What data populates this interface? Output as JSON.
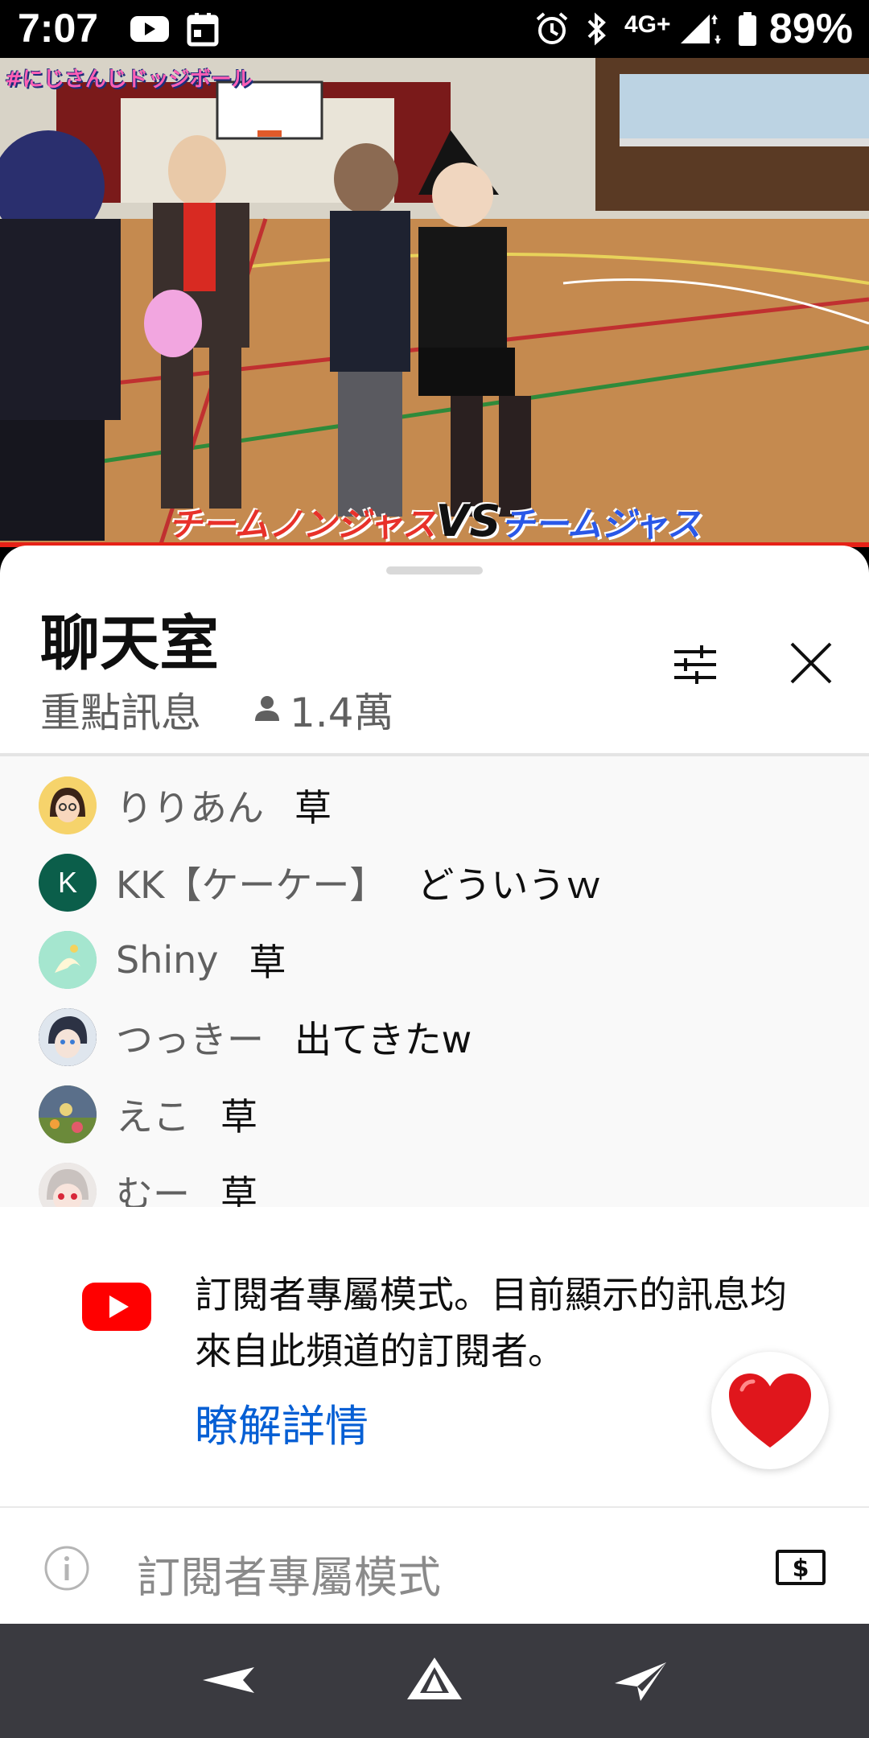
{
  "status_bar": {
    "time": "7:07",
    "network": "4G+",
    "battery": "89%"
  },
  "video": {
    "tag": "#にじさんじドッジボール",
    "caption_left": "チームノンジャス",
    "caption_vs": "VS",
    "caption_right": "チームジャス",
    "progress_color": "#e62117"
  },
  "chat": {
    "title": "聊天室",
    "mode": "重點訊息",
    "viewer_count": "1.4萬",
    "messages": [
      {
        "author": "りりあん",
        "text": "草",
        "avatar": "girl-avatar",
        "avatar_color": "#f6d36b"
      },
      {
        "author": "KK【ケーケー】",
        "text": "どういうｗ",
        "avatar_letter": "K",
        "avatar_color": "#0b5e4a"
      },
      {
        "author": "Shiny",
        "text": "草",
        "avatar": "dragon-avatar",
        "avatar_color": "#7fd6b7"
      },
      {
        "author": "つっきー",
        "text": "出てきたw",
        "avatar": "anime-avatar",
        "avatar_color": "#2c3244"
      },
      {
        "author": "えこ",
        "text": "草",
        "avatar": "scenery-avatar",
        "avatar_color": "#6a7a4a"
      },
      {
        "author": "むー",
        "text": "草",
        "avatar": "white-hair-avatar",
        "avatar_color": "#d7d1cf"
      }
    ],
    "notice": {
      "text": "訂閱者專屬模式。目前顯示的訊息均來自此頻道的訂閱者。",
      "link": "瞭解詳情"
    },
    "input_placeholder": "訂閱者專屬模式",
    "accent_color": "#065fd4"
  }
}
